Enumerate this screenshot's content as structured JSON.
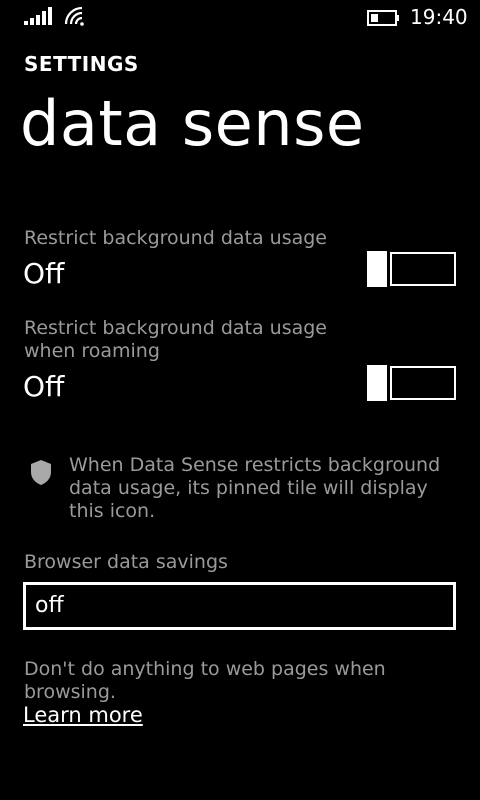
{
  "status_bar": {
    "time": "19:40",
    "signal_icon": "signal-bars-icon",
    "wifi_icon": "wifi-icon",
    "battery_icon": "battery-icon",
    "signal_level": 1.0,
    "battery_level": 0.3
  },
  "header": {
    "app_title": "SETTINGS",
    "page_title": "data sense"
  },
  "settings": [
    {
      "label": "Restrict background data usage",
      "value": "Off",
      "toggle_on": false
    },
    {
      "label": "Restrict background data usage when roaming",
      "value": "Off",
      "toggle_on": false
    }
  ],
  "info": {
    "icon": "shield-icon",
    "text": "When Data Sense restricts background data usage, its pinned tile will display this icon."
  },
  "browser_savings": {
    "label": "Browser data savings",
    "value": "off",
    "description": "Don't do anything to web pages when browsing.",
    "learn_more": "Learn more"
  },
  "colors": {
    "background": "#000000",
    "foreground": "#ffffff",
    "subtle_text": "#9a9a9a"
  }
}
